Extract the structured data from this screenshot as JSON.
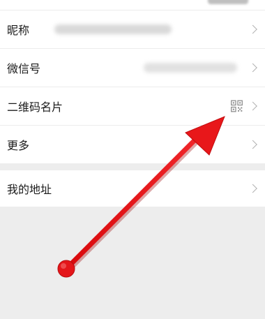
{
  "settings": {
    "rows": [
      {
        "label": "昵称"
      },
      {
        "label": "微信号"
      },
      {
        "label": "二维码名片"
      },
      {
        "label": "更多"
      }
    ],
    "address": {
      "label": "我的地址"
    }
  },
  "icons": {
    "qr": "qr-code-icon",
    "chevron": "chevron-right-icon"
  },
  "colors": {
    "background": "#ededed",
    "row_background": "#ffffff",
    "chevron": "#b2b2b2",
    "annotation_arrow": "#e8171a"
  }
}
